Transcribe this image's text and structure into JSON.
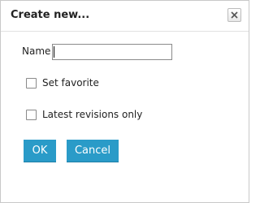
{
  "dialog": {
    "title": "Create new...",
    "close_icon": "close-x-icon"
  },
  "form": {
    "name_label": "Name",
    "name_value": "",
    "set_favorite_label": "Set favorite",
    "set_favorite_checked": false,
    "latest_revisions_label": "Latest revisions only",
    "latest_revisions_checked": false
  },
  "buttons": {
    "ok_label": "OK",
    "cancel_label": "Cancel"
  },
  "colors": {
    "button_accent": "#2a9bc8"
  }
}
